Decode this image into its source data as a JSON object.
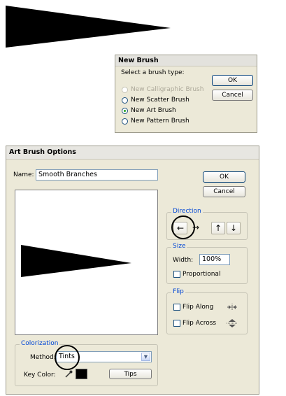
{
  "new_brush": {
    "title": "New Brush",
    "prompt": "Select a brush type:",
    "options": [
      {
        "label": "New Calligraphic Brush",
        "enabled": false,
        "selected": false
      },
      {
        "label": "New Scatter Brush",
        "enabled": true,
        "selected": false
      },
      {
        "label": "New Art Brush",
        "enabled": true,
        "selected": true
      },
      {
        "label": "New Pattern Brush",
        "enabled": true,
        "selected": false
      }
    ],
    "ok_label": "OK",
    "cancel_label": "Cancel"
  },
  "art_brush": {
    "title": "Art Brush Options",
    "name_label": "Name:",
    "name_value": "Smooth Branches",
    "ok_label": "OK",
    "cancel_label": "Cancel",
    "direction": {
      "legend": "Direction",
      "buttons": [
        {
          "icon": "arrow-left-icon",
          "glyph": "←",
          "selected": true
        },
        {
          "icon": "arrow-right-icon",
          "glyph": "→",
          "selected": false
        },
        {
          "icon": "arrow-up-icon",
          "glyph": "↑",
          "selected": false
        },
        {
          "icon": "arrow-down-icon",
          "glyph": "↓",
          "selected": false
        }
      ]
    },
    "size": {
      "legend": "Size",
      "width_label": "Width:",
      "width_value": "100%",
      "proportional_label": "Proportional",
      "proportional_checked": false
    },
    "flip": {
      "legend": "Flip",
      "along_label": "Flip Along",
      "along_checked": false,
      "across_label": "Flip Across",
      "across_checked": false
    },
    "colorization": {
      "legend": "Colorization",
      "method_label": "Method:",
      "method_value": "Tints",
      "key_color_label": "Key Color:",
      "key_color": "#000000",
      "tips_label": "Tips"
    }
  },
  "colors": {
    "dialog_bg": "#ece9d8",
    "legend_text": "#0046d5",
    "button_border": "#003c74",
    "radio_selected": "#21a121",
    "brush_fill": "#000000"
  }
}
